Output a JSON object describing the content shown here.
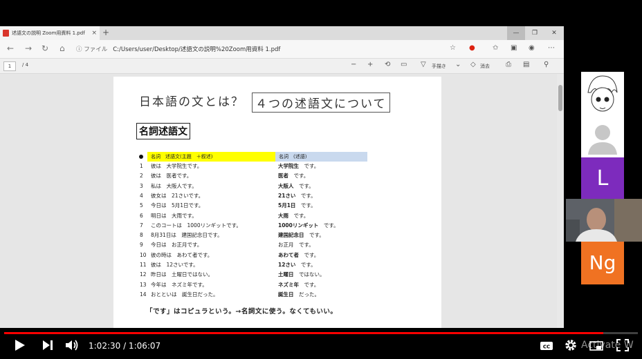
{
  "browser": {
    "tab_title": "述語文の説明 Zoom用資料 1.pdf",
    "tab_close": "×",
    "new_tab": "+",
    "win_min": "—",
    "win_max": "❐",
    "win_close": "✕",
    "url_label": "ファイル",
    "url": "C:/Users/user/Desktop/述語文の説明%20Zoom用資料 1.pdf"
  },
  "pdf_toolbar": {
    "page_current": "1",
    "page_total": "/ 4",
    "draw_label": "手描き",
    "erase_label": "消去"
  },
  "document": {
    "title_main": "日本語の文とは？",
    "title_boxed": "４つの述語文について",
    "section_heading": "名詞述語文",
    "header_left": "名詞　述語文(主題　＋叙述)",
    "header_right": "名詞　(述語)",
    "rows": [
      {
        "num": "1",
        "sentence": "彼は　大学院生です。",
        "pred_bold": "大学院生",
        "pred_rest": "　です。"
      },
      {
        "num": "2",
        "sentence": "彼は　医者です。",
        "pred_bold": "医者",
        "pred_rest": "　です。"
      },
      {
        "num": "3",
        "sentence": "私は　大阪人です。",
        "pred_bold": "大阪人",
        "pred_rest": "　です。"
      },
      {
        "num": "4",
        "sentence": "彼女は　21さいです。",
        "pred_bold": "21さい",
        "pred_rest": "　です。"
      },
      {
        "num": "5",
        "sentence": "今日は　5月1日です。",
        "pred_bold": "5月1日",
        "pred_rest": "　です。"
      },
      {
        "num": "6",
        "sentence": "明日は　大雨です。",
        "pred_bold": "大雨",
        "pred_rest": "　です。"
      },
      {
        "num": "7",
        "sentence": "このコートは　1000リンギットです。",
        "pred_bold": "1000リンギット",
        "pred_rest": "　です。"
      },
      {
        "num": "8",
        "sentence": "8月31日は　建国記念日です。",
        "pred_bold": "建国記念日",
        "pred_rest": "　です。"
      },
      {
        "num": "9",
        "sentence": "今日は　お正月です。",
        "pred_bold": "",
        "pred_rest": "お正月　です。"
      },
      {
        "num": "10",
        "sentence": "彼の時は　あわて者です。",
        "pred_bold": "あわて者",
        "pred_rest": "　です。"
      },
      {
        "num": "11",
        "sentence": "彼は　12さいです。",
        "pred_bold": "12さい",
        "pred_rest": "　です。"
      },
      {
        "num": "12",
        "sentence": "昨日は　土曜日ではない。",
        "pred_bold": "土曜日",
        "pred_rest": "　ではない。"
      },
      {
        "num": "13",
        "sentence": "今年は　ネズミ年です。",
        "pred_bold": "ネズミ年",
        "pred_rest": "　です。"
      },
      {
        "num": "14",
        "sentence": "おとといは　誕生日だった。",
        "pred_bold": "誕生日",
        "pred_rest": "　だった。"
      }
    ],
    "note": "「です」はコピュラという。→名詞文に使う。なくてもいい。"
  },
  "participants": {
    "tile3_initial": "L",
    "tile5_initial": "Ng"
  },
  "video": {
    "time": "1:02:30 / 1:06:07",
    "progress": 0.945,
    "watermark": "Activate W"
  }
}
